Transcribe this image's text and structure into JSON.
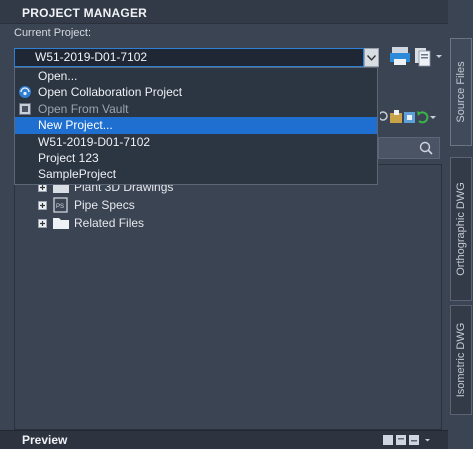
{
  "header": {
    "title": "PROJECT MANAGER"
  },
  "current_project": {
    "label": "Current Project:",
    "value": "W51-2019-D01-7102"
  },
  "dropdown": {
    "items": [
      {
        "label": "Open...",
        "icon": "",
        "state": "normal"
      },
      {
        "label": "Open Collaboration Project",
        "icon": "collaboration-globe-icon",
        "state": "normal"
      },
      {
        "label": "Open From Vault",
        "icon": "vault-icon",
        "state": "disabled"
      },
      {
        "label": "New Project...",
        "icon": "",
        "state": "selected"
      },
      {
        "label": "W51-2019-D01-7102",
        "icon": "",
        "state": "normal"
      },
      {
        "label": "Project 123",
        "icon": "",
        "state": "normal"
      },
      {
        "label": "SampleProject",
        "icon": "",
        "state": "normal"
      }
    ]
  },
  "tree": {
    "items": [
      {
        "label": "Plant 3D Drawings",
        "icon": "folder-icon"
      },
      {
        "label": "Pipe Specs",
        "icon": "pipe-spec-icon"
      },
      {
        "label": "Related Files",
        "icon": "folder-icon"
      }
    ]
  },
  "preview": {
    "label": "Preview"
  },
  "side_tabs": [
    {
      "label": "Source Files",
      "active": true
    },
    {
      "label": "Orthographic DWG",
      "active": false
    },
    {
      "label": "Isometric DWG",
      "active": false
    }
  ],
  "colors": {
    "selection": "#1f6fd0",
    "panel_bg": "#3b4453",
    "field_bg": "#1e2733"
  }
}
